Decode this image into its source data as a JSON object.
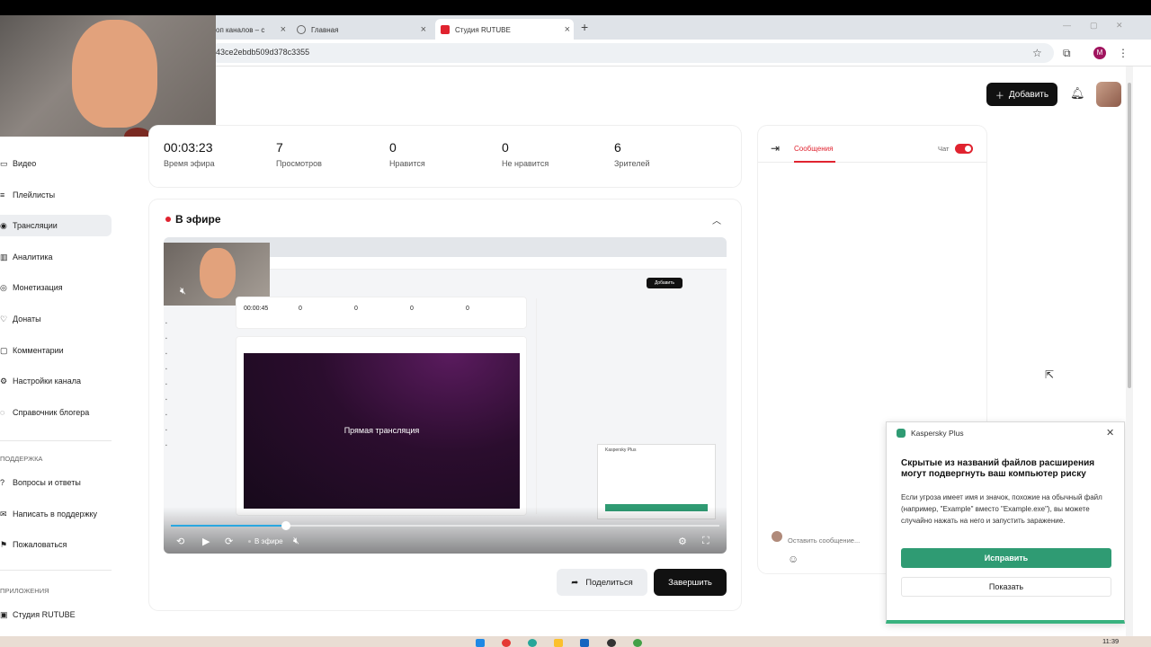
{
  "browser": {
    "tabs": [
      {
        "title": "оп каналов – с",
        "active": false
      },
      {
        "title": "Главная",
        "active": false
      },
      {
        "title": "Студия RUTUBE",
        "active": true
      }
    ],
    "url": "43ce2ebdb509d378c3355",
    "profile_initial": "M"
  },
  "header": {
    "add_label": "Добавить"
  },
  "sidebar": {
    "items": [
      {
        "label": "Видео",
        "icon": "video-icon"
      },
      {
        "label": "Плейлисты",
        "icon": "playlist-icon"
      },
      {
        "label": "Трансляции",
        "icon": "broadcast-icon",
        "active": true
      },
      {
        "label": "Аналитика",
        "icon": "analytics-icon"
      },
      {
        "label": "Монетизация",
        "icon": "money-icon"
      },
      {
        "label": "Донаты",
        "icon": "donate-icon"
      },
      {
        "label": "Комментарии",
        "icon": "comment-icon"
      },
      {
        "label": "Настройки канала",
        "icon": "gear-icon"
      },
      {
        "label": "Справочник блогера",
        "icon": "help-icon"
      }
    ],
    "support_title": "ПОДДЕРЖКА",
    "support_items": [
      {
        "label": "Вопросы и ответы"
      },
      {
        "label": "Написать в поддержку"
      },
      {
        "label": "Пожаловаться"
      }
    ],
    "apps_title": "ПРИЛОЖЕНИЯ",
    "apps_items": [
      {
        "label": "Студия RUTUBE"
      }
    ]
  },
  "stats": [
    {
      "value": "00:03:23",
      "label": "Время эфира"
    },
    {
      "value": "7",
      "label": "Просмотров"
    },
    {
      "value": "0",
      "label": "Нравится"
    },
    {
      "value": "0",
      "label": "Не нравится"
    },
    {
      "value": "6",
      "label": "Зрителей"
    }
  ],
  "live": {
    "title": "В эфире",
    "player_live_label": "В эфире",
    "progress_fraction": 0.21,
    "mini": {
      "time": "00:00:45",
      "stats": [
        "0",
        "0",
        "0",
        "0"
      ],
      "video_label": "Прямая трансляция",
      "add_label": "Добавить",
      "popup_title": "Kaspersky Plus"
    },
    "share_label": "Поделиться",
    "end_label": "Завершить"
  },
  "chat": {
    "tab_label": "Сообщения",
    "toggle_label": "Чат",
    "toggle_on": true,
    "input_placeholder": "Оставить сообщение..."
  },
  "kaspersky": {
    "product": "Kaspersky Plus",
    "title": "Скрытые из названий файлов расширения могут подвергнуть ваш компьютер риску",
    "text": "Если угроза имеет имя и значок, похожие на обычный файл (например, \"Example\" вместо \"Example.exe\"), вы можете случайно нажать на него и запустить заражение.",
    "fix_label": "Исправить",
    "show_label": "Показать"
  },
  "taskbar": {
    "time": "11:39"
  },
  "colors": {
    "accent_red": "#e0232f",
    "kaspersky_green": "#2f9b73"
  }
}
